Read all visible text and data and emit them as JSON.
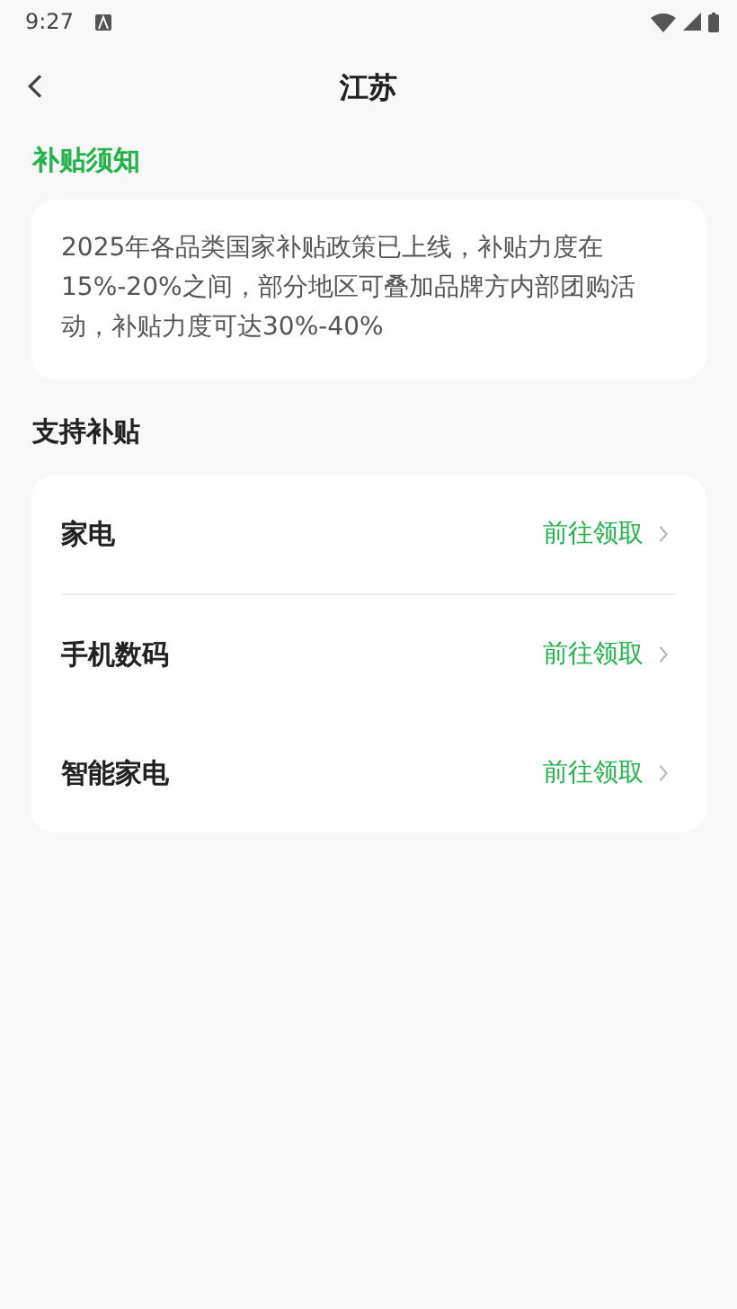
{
  "status_bar": {
    "time": "9:27"
  },
  "header": {
    "title": "江苏"
  },
  "notice": {
    "title": "补贴须知",
    "text": "2025年各品类国家补贴政策已上线，补贴力度在15%-20%之间，部分地区可叠加品牌方内部团购活动，补贴力度可达30%-40%"
  },
  "support": {
    "title": "支持补贴",
    "items": [
      {
        "label": "家电",
        "action": "前往领取",
        "divider": true
      },
      {
        "label": "手机数码",
        "action": "前往领取",
        "divider": false
      },
      {
        "label": "智能家电",
        "action": "前往领取",
        "divider": false
      }
    ]
  }
}
